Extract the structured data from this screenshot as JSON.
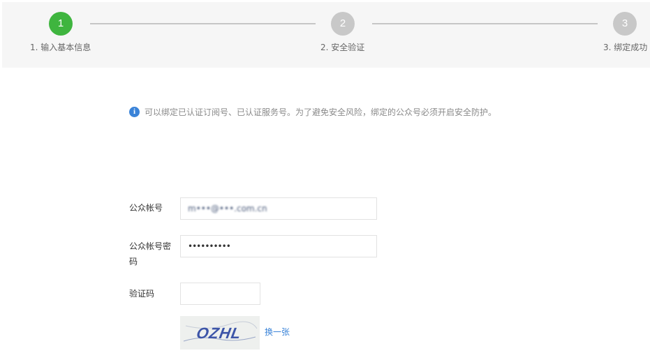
{
  "stepper": {
    "steps": [
      {
        "number": "1",
        "label": "1. 输入基本信息",
        "state": "active"
      },
      {
        "number": "2",
        "label": "2. 安全验证",
        "state": "inactive"
      },
      {
        "number": "3",
        "label": "3. 绑定成功",
        "state": "inactive"
      }
    ]
  },
  "notice": {
    "icon": "info-icon",
    "text": "可以绑定已认证订阅号、已认证服务号。为了避免安全风险，绑定的公众号必须开启安全防护。"
  },
  "form": {
    "account_label": "公众帐号",
    "account_value": "m•••@•••.com.cn",
    "password_label_line1": "公众帐号密",
    "password_label_line2": "码",
    "password_value": "••••••••••",
    "captcha_label": "验证码",
    "captcha_value": "",
    "captcha_text": "OZHL",
    "refresh_label": "换一张"
  },
  "colors": {
    "active_step": "#3fb53f",
    "inactive_step": "#c8c8c8",
    "link": "#3a83d8",
    "info_icon": "#3a83d8"
  }
}
